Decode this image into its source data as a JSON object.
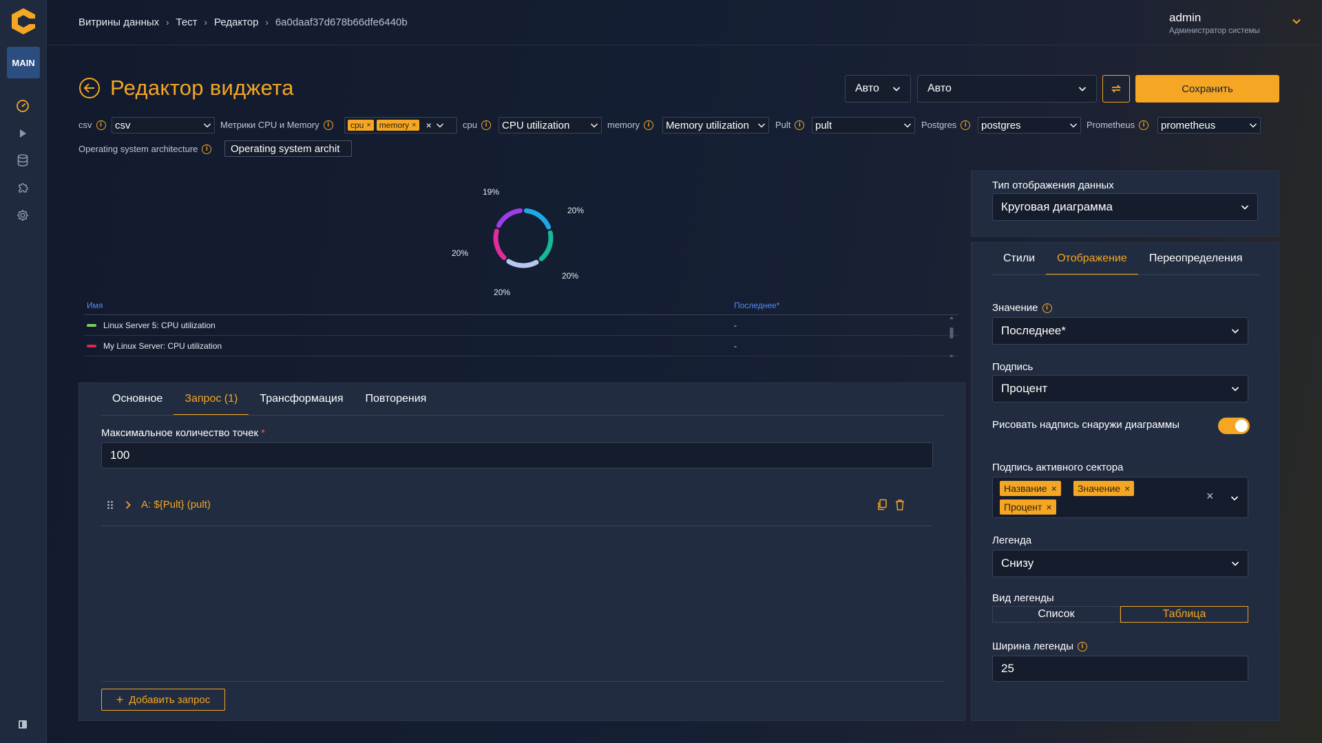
{
  "sidebar": {
    "badge": "MAIN",
    "icons": [
      "dashboard-icon",
      "play-icon",
      "database-icon",
      "plugin-icon",
      "settings-icon"
    ],
    "bottom_icon": "panel-toggle-icon"
  },
  "header": {
    "breadcrumbs": [
      "Витрины данных",
      "Тест",
      "Редактор",
      "6a0daaf37d678b66dfe6440b"
    ],
    "user_name": "admin",
    "user_role": "Администратор системы"
  },
  "title": "Редактор виджета",
  "toolbar": {
    "time_select_1": "Авто",
    "time_select_2": "Авто",
    "save_label": "Сохранить"
  },
  "variables": {
    "csv_label": "csv",
    "csv_value": "csv",
    "metrics_label": "Метрики CPU и Memory",
    "metrics_chips": [
      "cpu",
      "memory"
    ],
    "cpu_label": "cpu",
    "cpu_value": "CPU utilization",
    "memory_label": "memory",
    "memory_value": "Memory utilization",
    "pult_label": "Pult",
    "pult_value": "pult",
    "postgres_label": "Postgres",
    "postgres_value": "postgres",
    "prometheus_label": "Prometheus",
    "prometheus_value": "prometheus",
    "os_label": "Operating system architecture",
    "os_value": "Operating system archit"
  },
  "chart_data": {
    "type": "pie",
    "donut": true,
    "slices": [
      {
        "label": "20%",
        "value": 20,
        "color": "#1fa8e8"
      },
      {
        "label": "20%",
        "value": 20,
        "color": "#17b898"
      },
      {
        "label": "20%",
        "value": 20,
        "color": "#b6c8f0"
      },
      {
        "label": "20%",
        "value": 20,
        "color": "#e12c9c"
      },
      {
        "label": "19%",
        "value": 19,
        "color": "#9b3ee8"
      }
    ]
  },
  "legend_table": {
    "col_name": "Имя",
    "col_last": "Последнее*",
    "rows": [
      {
        "name": "Linux Server 5: CPU utilization",
        "last": "-",
        "color": "#7bd15a"
      },
      {
        "name": "My Linux Server: CPU utilization",
        "last": "-",
        "color": "#e5244f"
      }
    ]
  },
  "editor": {
    "tabs": [
      "Основное",
      "Запрос (1)",
      "Трансформация",
      "Повторения"
    ],
    "active_tab": 1,
    "max_points_label": "Максимальное количество точек",
    "required_mark": "*",
    "max_points_value": "100",
    "query_name": "A: ${Pult} (pult)",
    "add_query_label": "Добавить запрос"
  },
  "display_type": {
    "label": "Тип отображения данных",
    "value": "Круговая диаграмма"
  },
  "settings": {
    "tabs": [
      "Стили",
      "Отображение",
      "Переопределения"
    ],
    "active_tab": 1,
    "value_label": "Значение",
    "value_value": "Последнее*",
    "caption_label": "Подпись",
    "caption_value": "Процент",
    "outside_label": "Рисовать надпись снаружи диаграммы",
    "outside_on": true,
    "active_sector_label": "Подпись активного сектора",
    "active_sector_tags": [
      "Название",
      "Значение",
      "Процент"
    ],
    "legend_label": "Легенда",
    "legend_value": "Снизу",
    "legend_view_label": "Вид легенды",
    "legend_view_options": [
      "Список",
      "Таблица"
    ],
    "legend_view_selected": 1,
    "legend_width_label": "Ширина легенды",
    "legend_width_value": "25"
  },
  "colors": {
    "accent": "#f5a623",
    "panel": "#212c40",
    "link": "#4f8df2"
  }
}
